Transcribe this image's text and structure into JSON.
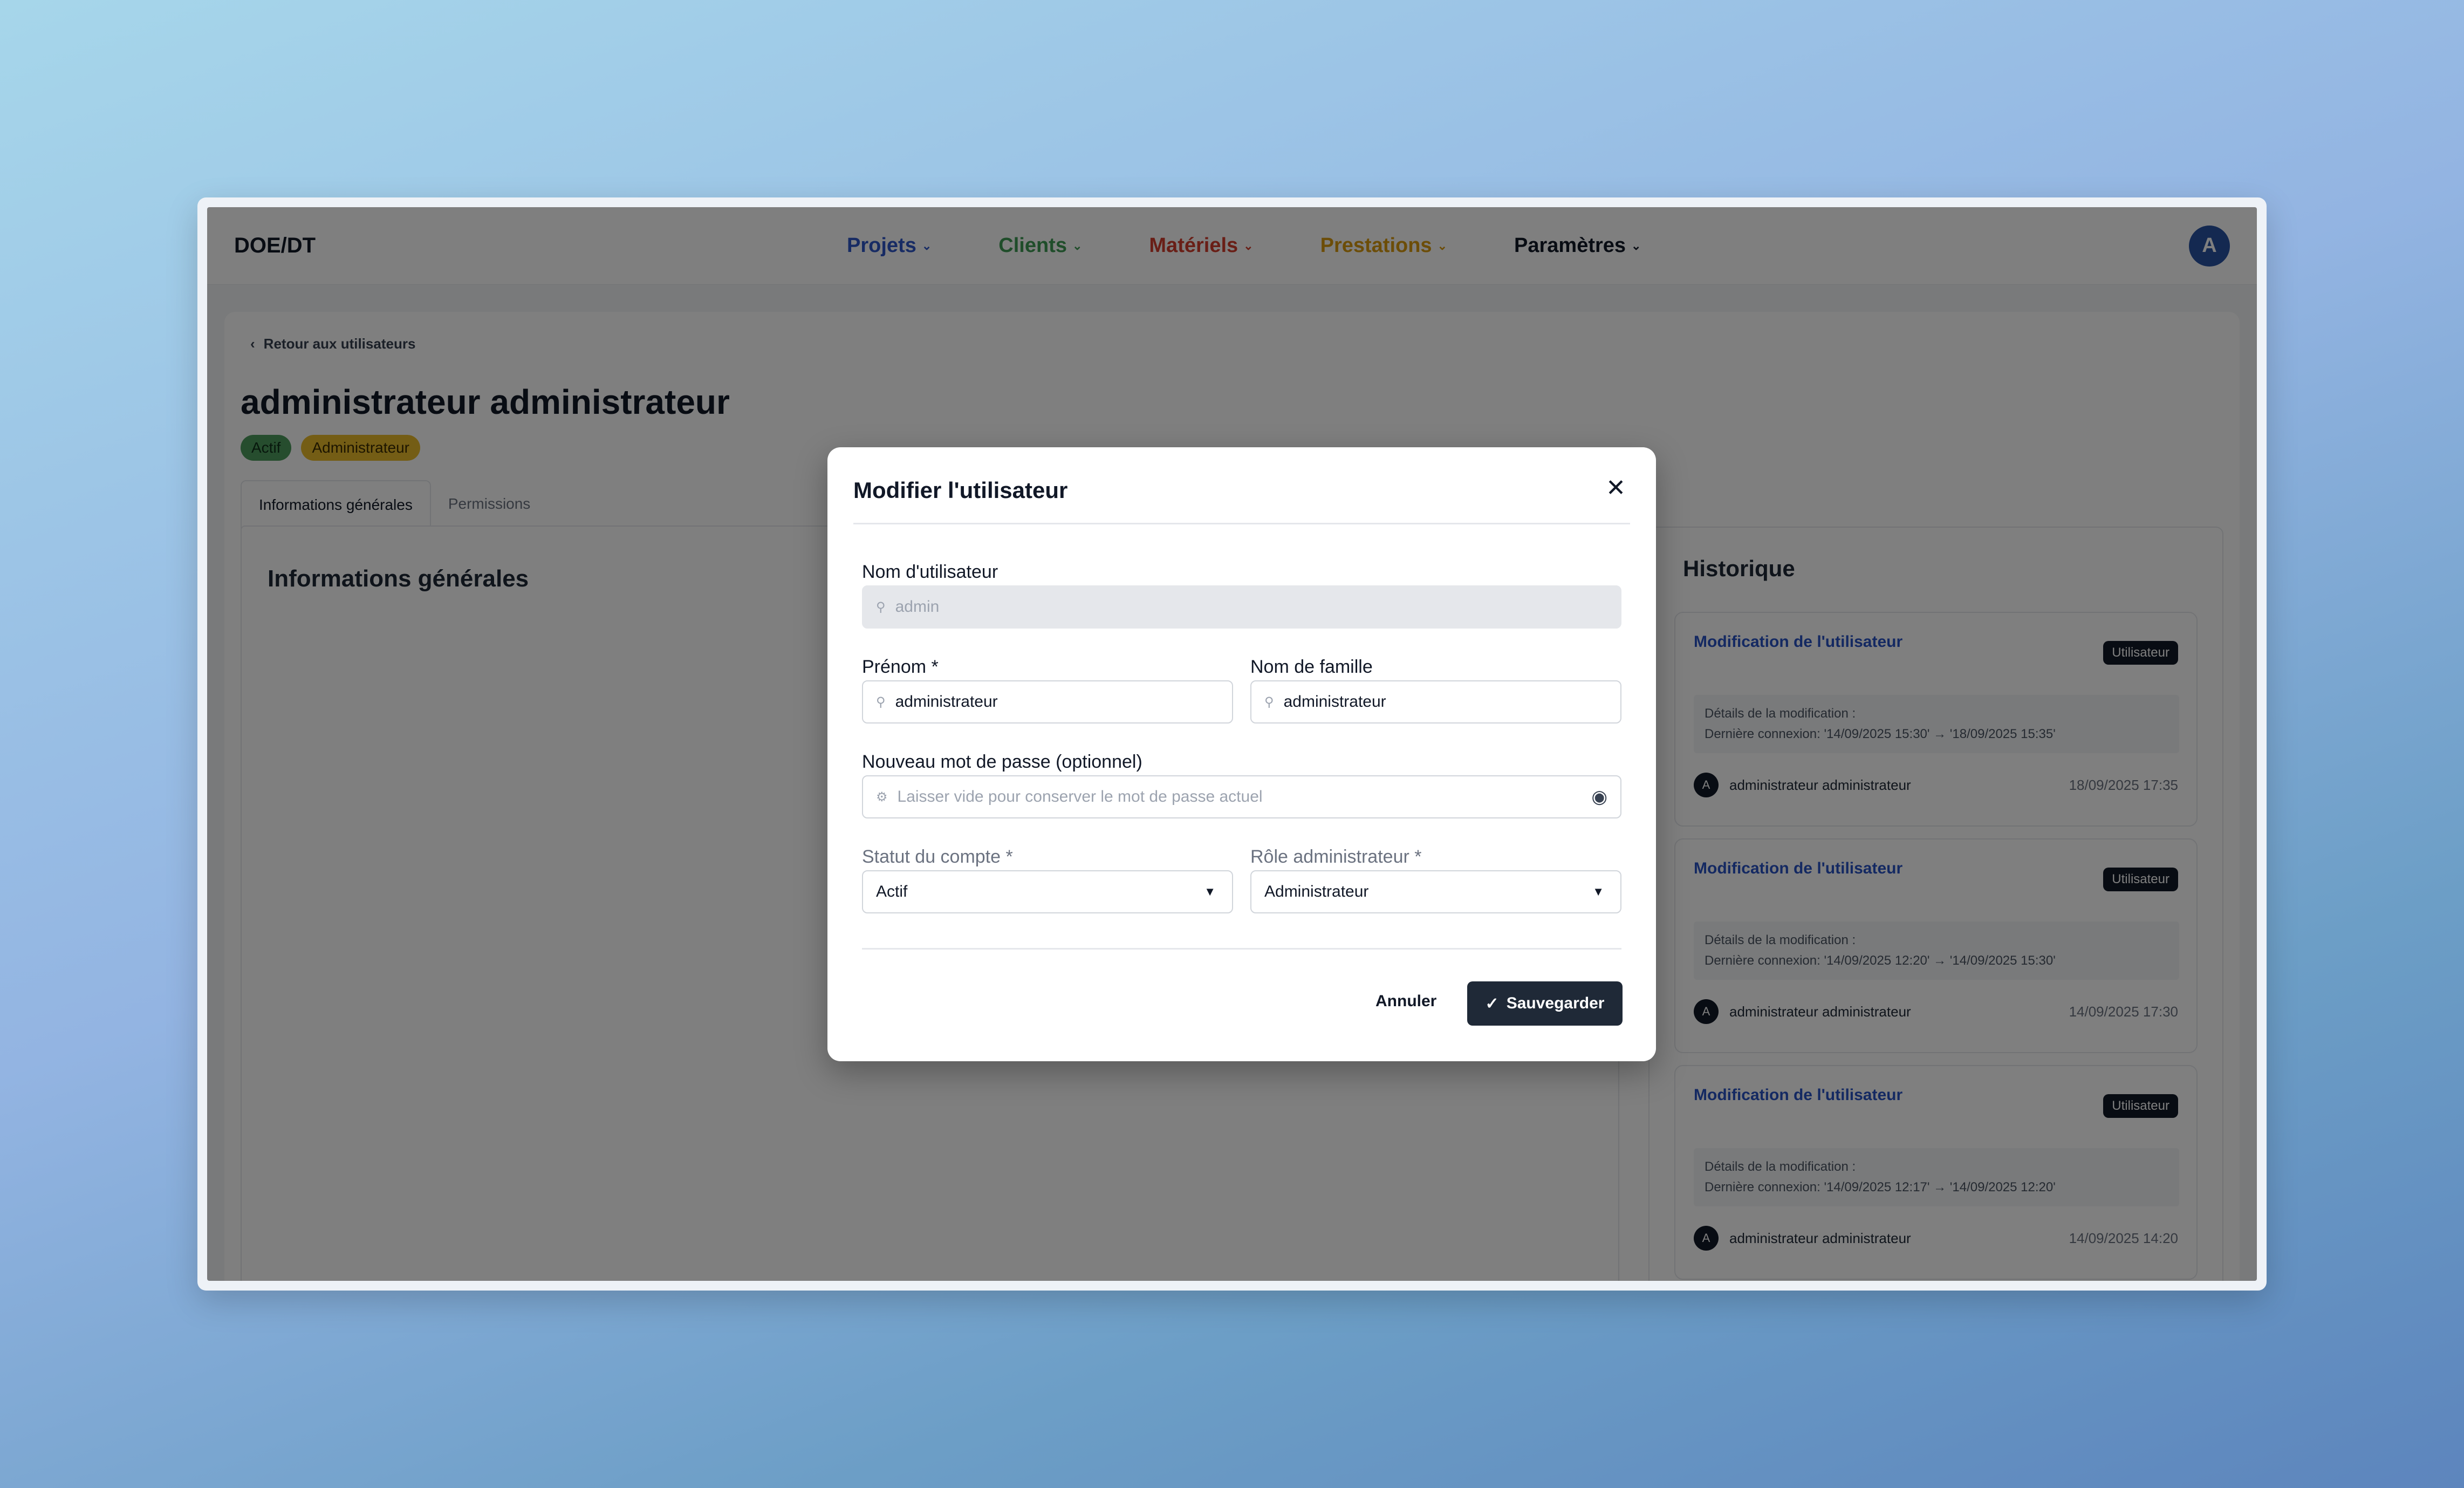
{
  "nav": {
    "brand": "DOE/DT",
    "items": [
      {
        "label": "Projets",
        "color": "#2f57c8"
      },
      {
        "label": "Clients",
        "color": "#3f9a55"
      },
      {
        "label": "Matériels",
        "color": "#d23c2c"
      },
      {
        "label": "Prestations",
        "color": "#d99a10"
      },
      {
        "label": "Paramètres",
        "color": "#111827"
      }
    ],
    "avatar": "A"
  },
  "page": {
    "back_label": "Retour aux utilisateurs",
    "title": "administrateur administrateur",
    "badges": [
      "Actif",
      "Administrateur"
    ],
    "tabs": [
      "Informations générales",
      "Permissions"
    ],
    "info_title": "Informations générales",
    "history_title": "Historique",
    "history": [
      {
        "action": "Modification de l'utilisateur",
        "badge": "Utilisateur",
        "detail_heading": "Détails de la modification :",
        "detail": "Dernière connexion: '14/09/2025 15:30' → '18/09/2025 15:35'",
        "avatar": "A",
        "user": "administrateur administrateur",
        "time": "18/09/2025 17:35"
      },
      {
        "action": "Modification de l'utilisateur",
        "badge": "Utilisateur",
        "detail_heading": "Détails de la modification :",
        "detail": "Dernière connexion: '14/09/2025 12:20' → '14/09/2025 15:30'",
        "avatar": "A",
        "user": "administrateur administrateur",
        "time": "14/09/2025 17:30"
      },
      {
        "action": "Modification de l'utilisateur",
        "badge": "Utilisateur",
        "detail_heading": "Détails de la modification :",
        "detail": "Dernière connexion: '14/09/2025 12:17' → '14/09/2025 12:20'",
        "avatar": "A",
        "user": "administrateur administrateur",
        "time": "14/09/2025 14:20"
      }
    ]
  },
  "modal": {
    "title": "Modifier l'utilisateur",
    "username_label": "Nom d'utilisateur",
    "username_value": "admin",
    "firstname_label": "Prénom *",
    "firstname_value": "administrateur",
    "lastname_label": "Nom de famille",
    "lastname_value": "administrateur",
    "password_label": "Nouveau mot de passe (optionnel)",
    "password_placeholder": "Laisser vide pour conserver le mot de passe actuel",
    "status_label": "Statut du compte *",
    "status_value": "Actif",
    "role_label": "Rôle administrateur *",
    "role_value": "Administrateur",
    "cancel_label": "Annuler",
    "save_label": "Sauvegarder"
  }
}
